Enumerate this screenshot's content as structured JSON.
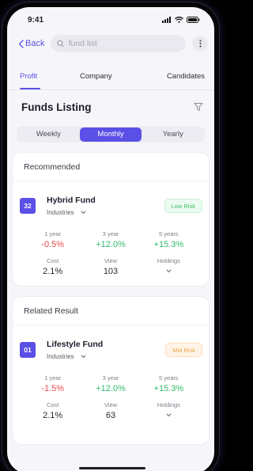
{
  "status": {
    "time": "9:41"
  },
  "nav": {
    "back_label": "Back",
    "search_placeholder": "fund list"
  },
  "tabs": [
    {
      "label": "Profit",
      "active": true
    },
    {
      "label": "Company",
      "active": false
    },
    {
      "label": "Candidates",
      "active": false
    }
  ],
  "listing": {
    "title": "Funds Listing"
  },
  "period": {
    "options": [
      "Weekly",
      "Monthly",
      "Yearly"
    ],
    "selected": "Monthly"
  },
  "recommended": {
    "header": "Recommended",
    "fund": {
      "badge": "32",
      "name": "Hybrid Fund",
      "category": "Industries",
      "risk": "Low Risk",
      "metrics": [
        {
          "label": "1 year",
          "value": "-0.5%"
        },
        {
          "label": "3 year",
          "value": "+12.0%"
        },
        {
          "label": "5 years",
          "value": "+15.3%"
        },
        {
          "label": "Cost",
          "value": "2.1%"
        },
        {
          "label": "View",
          "value": "103"
        },
        {
          "label": "Holdings",
          "value": ""
        }
      ]
    }
  },
  "related": {
    "header": "Related Result",
    "fund": {
      "badge": "01",
      "name": "Lifestyle Fund",
      "category": "Industries",
      "risk": "Mid Risk",
      "metrics": [
        {
          "label": "1 year",
          "value": "-1.5%"
        },
        {
          "label": "3 year",
          "value": "+12.0%"
        },
        {
          "label": "5 years",
          "value": "+15.3%"
        },
        {
          "label": "Cost",
          "value": "2.1%"
        },
        {
          "label": "View",
          "value": "63"
        },
        {
          "label": "Holdings",
          "value": ""
        }
      ]
    }
  },
  "colors": {
    "accent": "#5b50e6",
    "negative": "#e5484d",
    "positive": "#32b96b",
    "low_risk": "#3fbf6a",
    "mid_risk": "#f1a347"
  },
  "icons": [
    "signal-icon",
    "wifi-icon",
    "battery-icon",
    "chevron-left-icon",
    "search-icon",
    "more-icon",
    "filter-icon",
    "chevron-down-icon"
  ]
}
